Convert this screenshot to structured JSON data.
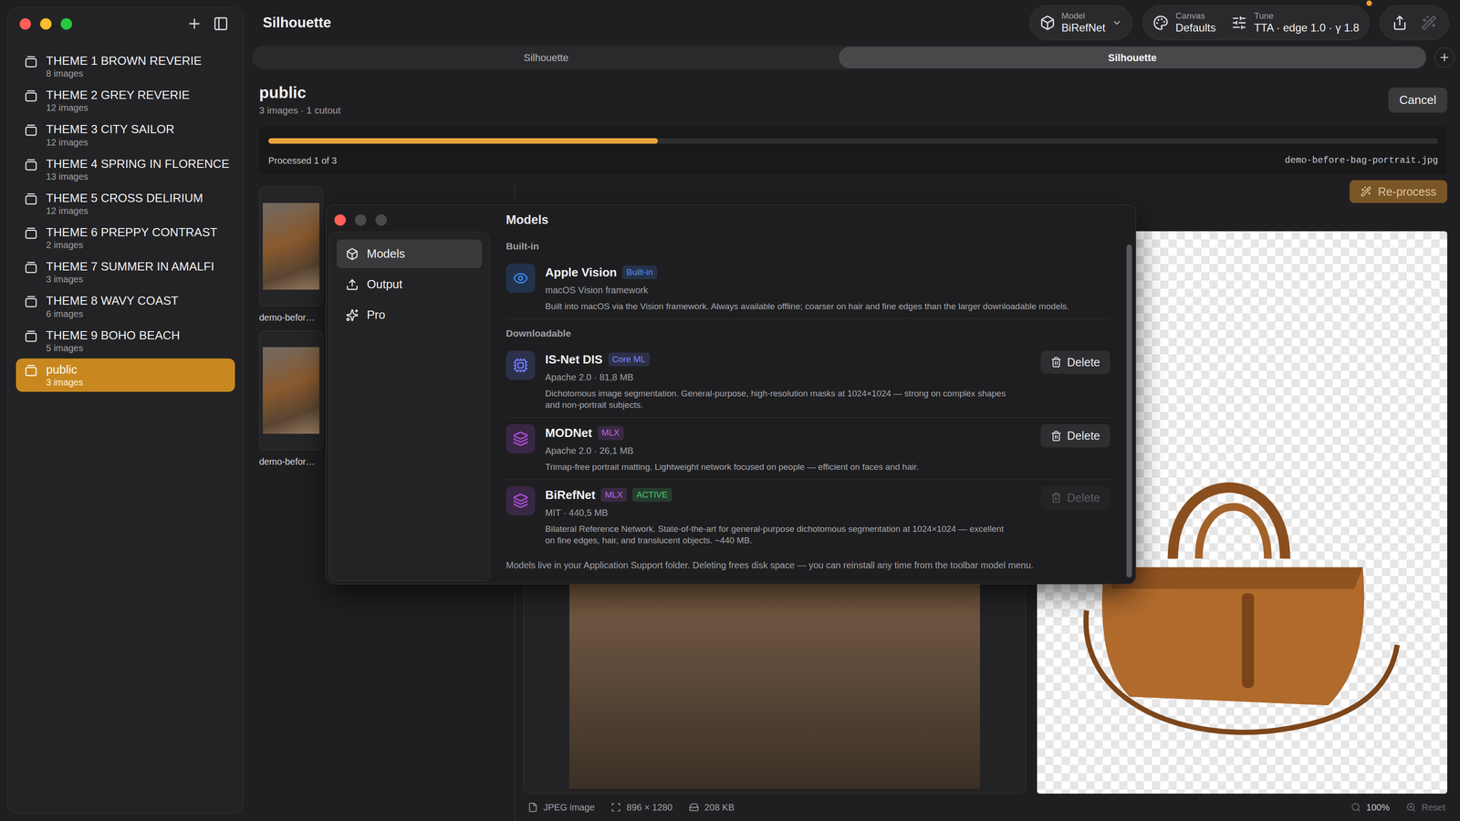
{
  "window": {
    "title": "Silhouette"
  },
  "sidebar": {
    "items": [
      {
        "name": "THEME 1 BROWN REVERIE",
        "count": "8 images",
        "selected": false
      },
      {
        "name": "THEME 2 GREY REVERIE",
        "count": "12 images",
        "selected": false
      },
      {
        "name": "THEME 3 CITY SAILOR",
        "count": "12 images",
        "selected": false
      },
      {
        "name": "THEME 4 SPRING IN FLORENCE",
        "count": "13 images",
        "selected": false
      },
      {
        "name": "THEME 5 CROSS DELIRIUM",
        "count": "12 images",
        "selected": false
      },
      {
        "name": "THEME 6 PREPPY CONTRAST",
        "count": "2 images",
        "selected": false
      },
      {
        "name": "THEME 7 SUMMER IN AMALFI",
        "count": "3 images",
        "selected": false
      },
      {
        "name": "THEME 8 WAVY COAST",
        "count": "6 images",
        "selected": false
      },
      {
        "name": "THEME 9 BOHO BEACH",
        "count": "5 images",
        "selected": false
      },
      {
        "name": "public",
        "count": "3 images",
        "selected": true
      }
    ]
  },
  "toolbar": {
    "model": {
      "label": "Model",
      "value": "BiRefNet"
    },
    "canvas": {
      "label": "Canvas",
      "value": "Defaults"
    },
    "tune": {
      "label": "Tune",
      "value": "TTA · edge 1.0 · γ 1.8"
    },
    "notification": true,
    "magic_disabled": true
  },
  "tabs": [
    {
      "label": "Silhouette",
      "selected": false
    },
    {
      "label": "Silhouette",
      "selected": true
    }
  ],
  "header": {
    "title": "public",
    "subtitle": "3 images · 1 cutout",
    "cancel": "Cancel"
  },
  "progress": {
    "level": 0.333,
    "status": "Processed 1 of 3",
    "file": "demo-before-bag-portrait.jpg"
  },
  "thumbnails": [
    {
      "label": "demo-befor…"
    },
    {
      "label": "demo-befor…"
    }
  ],
  "preview": {
    "reprocess": {
      "label": "Re-process",
      "disabled": true
    }
  },
  "status_bar": {
    "type": "JPEG image",
    "dimensions": "896 × 1280",
    "size": "208 KB",
    "zoom": "100%",
    "reset": {
      "label": "Reset",
      "disabled": true
    }
  },
  "settings": {
    "controls": [
      {
        "kind": "close",
        "enabled": true
      },
      {
        "kind": "minimize",
        "enabled": false
      },
      {
        "kind": "zoom",
        "enabled": false
      }
    ],
    "nav": [
      {
        "label": "Models",
        "kind": "models",
        "selected": true
      },
      {
        "label": "Output",
        "kind": "output",
        "selected": false
      },
      {
        "label": "Pro",
        "kind": "pro",
        "selected": false
      }
    ],
    "title": "Models",
    "sections": [
      {
        "title": "Built-in",
        "models": [
          {
            "name": "Apple Vision",
            "kind": "eye",
            "color": "#3b8cff",
            "badges": [
              {
                "label": "Built-in",
                "color": "#4a90ff"
              }
            ],
            "meta": "macOS Vision framework",
            "description": "Built into macOS via the Vision framework. Always available offline; coarser on hair and fine edges than the larger downloadable models."
          }
        ]
      },
      {
        "title": "Downloadable",
        "models": [
          {
            "name": "IS-Net DIS",
            "kind": "chip",
            "color": "#6d7dff",
            "badges": [
              {
                "label": "Core ML",
                "color": "#7b86ff"
              }
            ],
            "meta": "Apache 2.0 · 81,8 MB",
            "description": "Dichotomous image segmentation. General-purpose, high-resolution masks at 1024×1024 — strong on complex shapes and non-portrait subjects.",
            "delete": {
              "label": "Delete",
              "disabled": false
            }
          },
          {
            "name": "MODNet",
            "kind": "layers",
            "color": "#b04fe0",
            "badges": [
              {
                "label": "MLX",
                "color": "#b866e6"
              }
            ],
            "meta": "Apache 2.0 · 26,1 MB",
            "description": "Trimap-free portrait matting. Lightweight network focused on people — efficient on faces and hair.",
            "delete": {
              "label": "Delete",
              "disabled": false
            }
          },
          {
            "name": "BiRefNet",
            "kind": "layers",
            "color": "#b04fe0",
            "badges": [
              {
                "label": "MLX",
                "color": "#b866e6"
              },
              {
                "label": "ACTIVE",
                "color": "#4cc870"
              }
            ],
            "meta": "MIT · 440,5 MB",
            "description": "Bilateral Reference Network. State-of-the-art for general-purpose dichotomous segmentation at 1024×1024 — excellent on fine edges, hair, and translucent objects. ~440 MB.",
            "delete": {
              "label": "Delete",
              "disabled": true
            }
          }
        ]
      }
    ],
    "footer": "Models live in your Application Support folder. Deleting frees disk space — you can reinstall any time from the toolbar model menu."
  }
}
